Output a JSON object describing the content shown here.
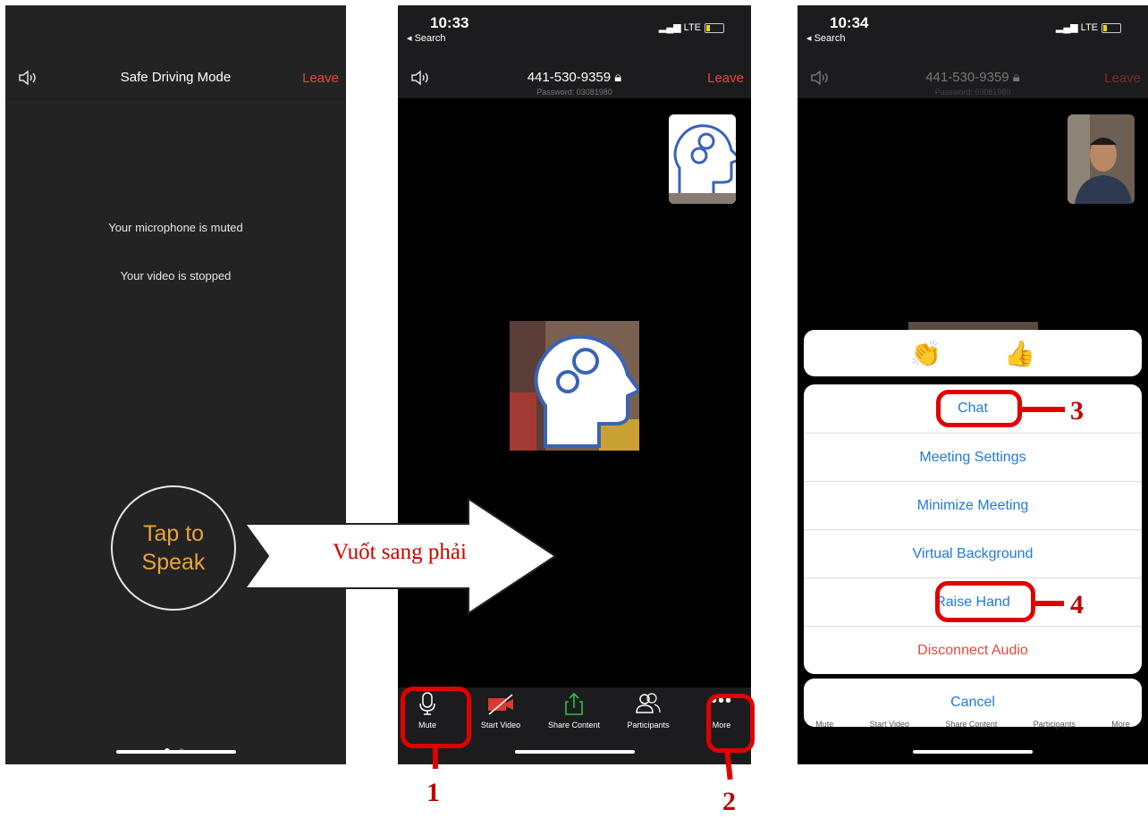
{
  "colors": {
    "leave_red": "#e5483c",
    "accent_blue": "#1f7ae0",
    "tap_orange": "#e8a33a",
    "callout_red": "#e00000"
  },
  "phone1": {
    "title": "Safe Driving Mode",
    "leave": "Leave",
    "mic_msg": "Your microphone is muted",
    "video_msg": "Your video is stopped",
    "tap_line1": "Tap to",
    "tap_line2": "Speak",
    "page_dots": {
      "count": 2,
      "active": 1
    }
  },
  "swipe_arrow": {
    "label": "Vuốt sang phải"
  },
  "phone2": {
    "time": "10:33",
    "back": "◂ Search",
    "network": "LTE",
    "meeting_id": "441-530-9359",
    "password": "Password: 03081980",
    "leave": "Leave",
    "toolbar": [
      {
        "label": "Mute",
        "icon": "microphone-icon"
      },
      {
        "label": "Start Video",
        "icon": "video-off-icon"
      },
      {
        "label": "Share Content",
        "icon": "share-up-arrow-icon"
      },
      {
        "label": "Participants",
        "icon": "participants-icon"
      },
      {
        "label": "More",
        "icon": "more-dots-icon"
      }
    ]
  },
  "phone3": {
    "time": "10:34",
    "back": "◂ Search",
    "network": "LTE",
    "meeting_id": "441-530-9359",
    "password": "Password: 03081980",
    "leave": "Leave",
    "reactions": [
      "👏",
      "👍"
    ],
    "menu": [
      "Chat",
      "Meeting Settings",
      "Minimize Meeting",
      "Virtual Background",
      "Raise Hand",
      "Disconnect Audio"
    ],
    "cancel": "Cancel",
    "toolbar_labels": [
      "Mute",
      "Start Video",
      "Share Content",
      "Participants",
      "More"
    ]
  },
  "callouts": [
    "1",
    "2",
    "3",
    "4"
  ]
}
